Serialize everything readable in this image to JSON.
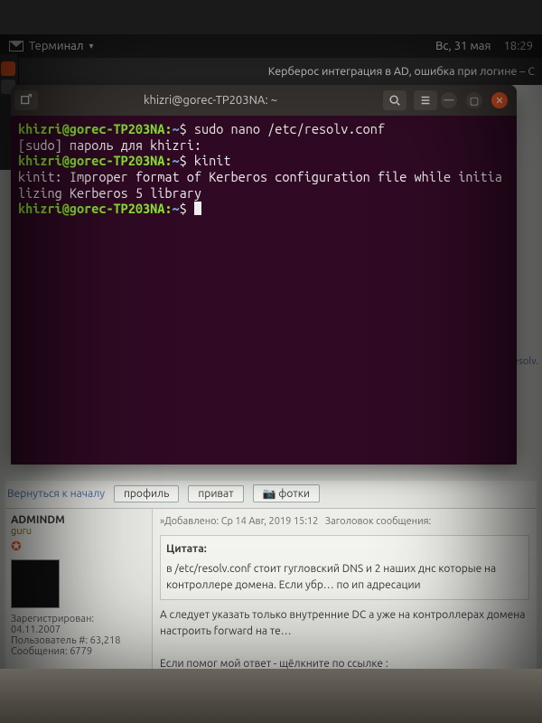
{
  "topbar": {
    "app_label": "Терминал",
    "date": "Вс, 31 мая",
    "time": "18:29"
  },
  "browser_tab": {
    "title": "Керберос интеграция в AD, ошибка при логине – С"
  },
  "terminal": {
    "title": "khizri@gorec-TP203NA: ~",
    "prompt_user": "khizri@gorec-TP203NA",
    "prompt_path": "~",
    "prompt_sep": ":",
    "prompt_sym": "$",
    "lines": {
      "cmd1": "sudo nano /etc/resolv.conf",
      "sudo": "[sudo] пароль для khizri:",
      "cmd2": "kinit",
      "err": "kinit: Improper format of Kerberos configuration file while initializing Kerberos 5 library"
    }
  },
  "forum": {
    "back_to_top": "Вернуться к началу",
    "buttons": {
      "profile": "профиль",
      "pm": "приват",
      "photos": "фотки"
    },
    "post": {
      "author": "ADMINDM",
      "rank": "guru",
      "reg_label": "Зарегистрирован:",
      "reg_date": "04.11.2007",
      "posts_count_label": "Пользователь #:",
      "posts_count": "63,218",
      "messages_label": "Сообщения:",
      "messages": "6779",
      "added_label": "Добавлено:",
      "added_date": "Ср 14 Авг, 2019 15:12",
      "subject_label": "Заголовок сообщения:",
      "quote_header": "Цитата:",
      "quote_body": "в /etc/resolv.conf стоит гугловский DNS и 2 наших днс которые на контроллере домена. Если убр… по ип адресации",
      "body_line1": "А следует указать только внутренние DC а уже на контроллерах домена настроить forward на те…",
      "sig_line": "Если помог мой ответ - щёлкните по ссылке :",
      "sig_link": "http://sysadmins.ru/reputation.php?a=add&u=63218&p=13191050&c=ac4064c1"
    },
    "side_hint": "resolv."
  }
}
